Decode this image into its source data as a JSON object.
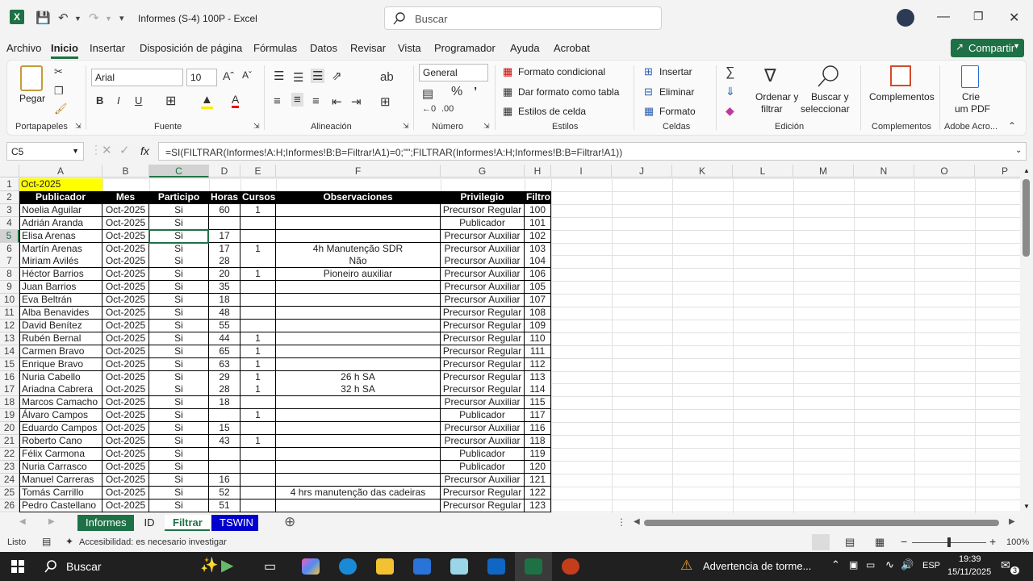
{
  "title_bar": {
    "doc_title": "Informes (S-4) 100P  -  Excel",
    "search_placeholder": "Buscar"
  },
  "menu": [
    "Archivo",
    "Inicio",
    "Insertar",
    "Disposición de página",
    "Fórmulas",
    "Datos",
    "Revisar",
    "Vista",
    "Programador",
    "Ayuda",
    "Acrobat"
  ],
  "share_label": "Compartir",
  "ribbon": {
    "paste": "Pegar",
    "font_name": "Arial",
    "font_size": "10",
    "number_format": "General",
    "cond_format": "Formato condicional",
    "table_format": "Dar formato como tabla",
    "cell_styles": "Estilos de celda",
    "insert": "Insertar",
    "delete": "Eliminar",
    "format": "Formato",
    "sort_filter_1": "Ordenar y",
    "sort_filter_2": "filtrar",
    "find_1": "Buscar y",
    "find_2": "seleccionar",
    "addins": "Complementos",
    "pdf_1": "Crie",
    "pdf_2": "um PDF",
    "groups": {
      "clipboard": "Portapapeles",
      "font": "Fuente",
      "alignment": "Alineación",
      "number": "Número",
      "styles": "Estilos",
      "cells": "Celdas",
      "editing": "Edición",
      "addins": "Complementos",
      "acrobat": "Adobe Acro..."
    }
  },
  "formula_bar": {
    "name_box": "C5",
    "fx": "fx",
    "formula": "=SI(FILTRAR(Informes!A:H;Informes!B:B=Filtrar!A1)=0;\"\";FILTRAR(Informes!A:H;Informes!B:B=Filtrar!A1))"
  },
  "columns": [
    "A",
    "B",
    "C",
    "D",
    "E",
    "F",
    "G",
    "H",
    "I",
    "J",
    "K",
    "L",
    "M",
    "N",
    "O",
    "P"
  ],
  "sheet": {
    "a1": "Oct-2025",
    "headers": [
      "Publicador",
      "Mes",
      "Participo",
      "Horas",
      "Cursos",
      "Observaciones",
      "Privilegio",
      "Filtro"
    ],
    "rows": [
      [
        "Noelia Aguilar",
        "Oct-2025",
        "Si",
        "60",
        "1",
        "",
        "Precursor Regular",
        "100"
      ],
      [
        "Adrián Aranda",
        "Oct-2025",
        "Si",
        "",
        "",
        "",
        "Publicador",
        "101"
      ],
      [
        "Elisa Arenas",
        "Oct-2025",
        "Si",
        "17",
        "",
        "",
        "Precursor Auxiliar",
        "102"
      ],
      [
        "Martín Arenas",
        "Oct-2025",
        "Si",
        "17",
        "1",
        "4h Manutenção SDR",
        "Precursor Auxiliar",
        "103"
      ],
      [
        "Miriam Avilés",
        "Oct-2025",
        "Si",
        "28",
        "",
        "Não",
        "Precursor Auxiliar",
        "104"
      ],
      [
        "Héctor Barrios",
        "Oct-2025",
        "Si",
        "20",
        "1",
        "Pioneiro auxiliar",
        "Precursor Auxiliar",
        "106"
      ],
      [
        "Juan Barrios",
        "Oct-2025",
        "Si",
        "35",
        "",
        "",
        "Precursor Auxiliar",
        "105"
      ],
      [
        "Eva Beltrán",
        "Oct-2025",
        "Si",
        "18",
        "",
        "",
        "Precursor Auxiliar",
        "107"
      ],
      [
        "Alba Benavides",
        "Oct-2025",
        "Si",
        "48",
        "",
        "",
        "Precursor Regular",
        "108"
      ],
      [
        "David Benítez",
        "Oct-2025",
        "Si",
        "55",
        "",
        "",
        "Precursor Regular",
        "109"
      ],
      [
        "Rubén Bernal",
        "Oct-2025",
        "Si",
        "44",
        "1",
        "",
        "Precursor Regular",
        "110"
      ],
      [
        "Carmen Bravo",
        "Oct-2025",
        "Si",
        "65",
        "1",
        "",
        "Precursor Regular",
        "111"
      ],
      [
        "Enrique Bravo",
        "Oct-2025",
        "Si",
        "63",
        "1",
        "",
        "Precursor Regular",
        "112"
      ],
      [
        "Nuria Cabello",
        "Oct-2025",
        "Si",
        "29",
        "1",
        "26 h SA",
        "Precursor Regular",
        "113"
      ],
      [
        "Ariadna Cabrera",
        "Oct-2025",
        "Si",
        "28",
        "1",
        "32 h SA",
        "Precursor Regular",
        "114"
      ],
      [
        "Marcos Camacho",
        "Oct-2025",
        "Si",
        "18",
        "",
        "",
        "Precursor Auxiliar",
        "115"
      ],
      [
        "Álvaro Campos",
        "Oct-2025",
        "Si",
        "",
        "1",
        "",
        "Publicador",
        "117"
      ],
      [
        "Eduardo Campos",
        "Oct-2025",
        "Si",
        "15",
        "",
        "",
        "Precursor Auxiliar",
        "116"
      ],
      [
        "Roberto Cano",
        "Oct-2025",
        "Si",
        "43",
        "1",
        "",
        "Precursor Auxiliar",
        "118"
      ],
      [
        "Félix Carmona",
        "Oct-2025",
        "Si",
        "",
        "",
        "",
        "Publicador",
        "119"
      ],
      [
        "Nuria Carrasco",
        "Oct-2025",
        "Si",
        "",
        "",
        "",
        "Publicador",
        "120"
      ],
      [
        "Manuel Carreras",
        "Oct-2025",
        "Si",
        "16",
        "",
        "",
        "Precursor Auxiliar",
        "121"
      ],
      [
        "Tomás Carrillo",
        "Oct-2025",
        "Si",
        "52",
        "",
        "4 hrs manutenção das cadeiras",
        "Precursor Regular",
        "122"
      ],
      [
        "Pedro Castellano",
        "Oct-2025",
        "Si",
        "51",
        "",
        "",
        "Precursor Regular",
        "123"
      ]
    ]
  },
  "tabs": [
    "Informes",
    "ID",
    "Filtrar",
    "TSWIN"
  ],
  "tab_colors": [
    "#1e7145",
    "#f3f3f3",
    "#ffffff",
    "#0000cc"
  ],
  "status": {
    "ready": "Listo",
    "accessibility": "Accesibilidad: es necesario investigar",
    "zoom": "100%"
  },
  "taskbar": {
    "search": "Buscar",
    "weather": "Advertencia de torme...",
    "lang": "ESP",
    "time": "19:39",
    "date": "15/11/2025",
    "notif": "3"
  }
}
